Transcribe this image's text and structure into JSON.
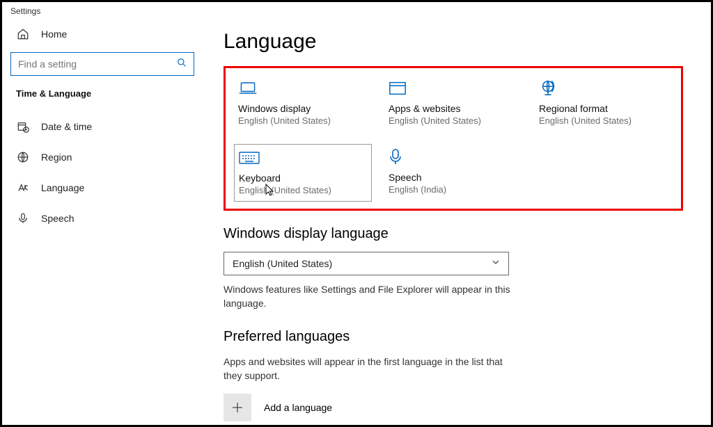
{
  "window_title": "Settings",
  "sidebar": {
    "home_label": "Home",
    "search_placeholder": "Find a setting",
    "category": "Time & Language",
    "items": [
      {
        "label": "Date & time"
      },
      {
        "label": "Region"
      },
      {
        "label": "Language"
      },
      {
        "label": "Speech"
      }
    ]
  },
  "main": {
    "title": "Language",
    "tiles": [
      {
        "label": "Windows display",
        "sub": "English (United States)"
      },
      {
        "label": "Apps & websites",
        "sub": "English (United States)"
      },
      {
        "label": "Regional format",
        "sub": "English (United States)"
      },
      {
        "label": "Keyboard",
        "sub": "English (United States)"
      },
      {
        "label": "Speech",
        "sub": "English (India)"
      }
    ],
    "display_lang_heading": "Windows display language",
    "display_lang_value": "English (United States)",
    "display_lang_desc": "Windows features like Settings and File Explorer will appear in this language.",
    "preferred_heading": "Preferred languages",
    "preferred_desc": "Apps and websites will appear in the first language in the list that they support.",
    "add_language_label": "Add a language"
  }
}
